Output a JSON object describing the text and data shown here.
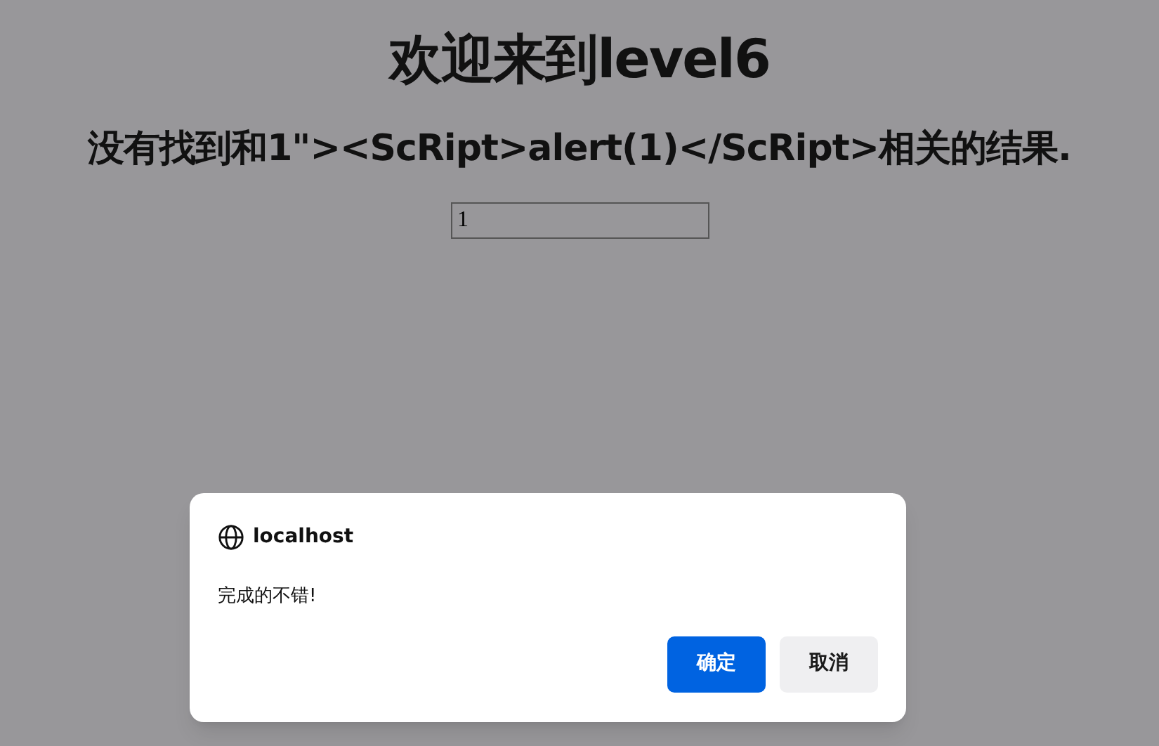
{
  "page": {
    "title": "欢迎来到level6",
    "message": "没有找到和1\"><ScRipt>alert(1)</ScRipt>相关的结果.",
    "search": {
      "value": "1"
    }
  },
  "dialog": {
    "origin": "localhost",
    "message": "完成的不错!",
    "buttons": [
      {
        "label": "确定",
        "kind": "primary"
      },
      {
        "label": "取消",
        "kind": "secondary"
      }
    ]
  }
}
